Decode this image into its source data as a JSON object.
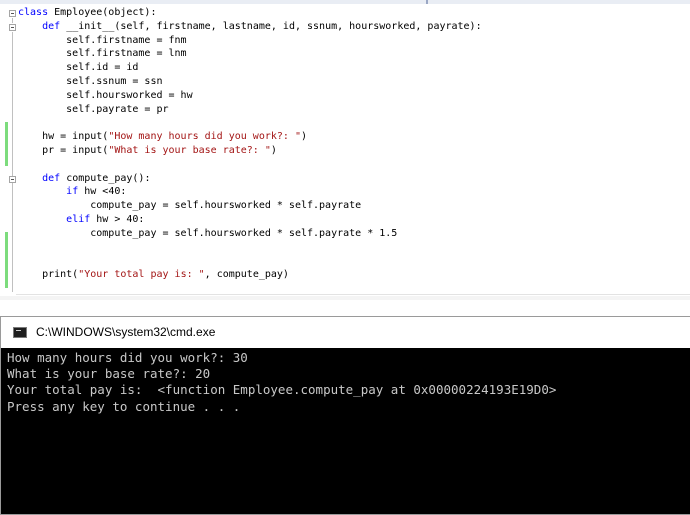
{
  "editor": {
    "lines": [
      [
        {
          "t": "class ",
          "c": "kw"
        },
        {
          "t": "Employee(object):",
          "c": ""
        }
      ],
      [
        {
          "t": "    ",
          "c": ""
        },
        {
          "t": "def ",
          "c": "kw"
        },
        {
          "t": "__init__(self, firstname, lastname, id, ssnum, hoursworked, payrate):",
          "c": ""
        }
      ],
      [
        {
          "t": "        self.firstname = fnm",
          "c": ""
        }
      ],
      [
        {
          "t": "        self.firstname = lnm",
          "c": ""
        }
      ],
      [
        {
          "t": "        self.id = id",
          "c": ""
        }
      ],
      [
        {
          "t": "        self.ssnum = ssn",
          "c": ""
        }
      ],
      [
        {
          "t": "        self.hoursworked = hw",
          "c": ""
        }
      ],
      [
        {
          "t": "        self.payrate = pr",
          "c": ""
        }
      ],
      [],
      [
        {
          "t": "    hw = input(",
          "c": ""
        },
        {
          "t": "\"How many hours did you work?: \"",
          "c": "str"
        },
        {
          "t": ")",
          "c": ""
        }
      ],
      [
        {
          "t": "    pr = input(",
          "c": ""
        },
        {
          "t": "\"What is your base rate?: \"",
          "c": "str"
        },
        {
          "t": ")",
          "c": ""
        }
      ],
      [],
      [
        {
          "t": "    ",
          "c": ""
        },
        {
          "t": "def ",
          "c": "kw"
        },
        {
          "t": "compute_pay():",
          "c": ""
        }
      ],
      [
        {
          "t": "        ",
          "c": ""
        },
        {
          "t": "if ",
          "c": "kw"
        },
        {
          "t": "hw <40:",
          "c": ""
        }
      ],
      [
        {
          "t": "            compute_pay = self.hoursworked * self.payrate",
          "c": ""
        }
      ],
      [
        {
          "t": "        ",
          "c": ""
        },
        {
          "t": "elif ",
          "c": "kw"
        },
        {
          "t": "hw > 40:",
          "c": ""
        }
      ],
      [
        {
          "t": "            compute_pay = self.hoursworked * self.payrate * 1.5",
          "c": ""
        }
      ],
      [],
      [],
      [
        {
          "t": "    print(",
          "c": ""
        },
        {
          "t": "\"Your total pay is: \"",
          "c": "str"
        },
        {
          "t": ", compute_pay)",
          "c": ""
        }
      ]
    ]
  },
  "console": {
    "title": "C:\\WINDOWS\\system32\\cmd.exe",
    "icon": "cmd-icon",
    "output_lines": [
      "How many hours did you work?: 30",
      "What is your base rate?: 20",
      "Your total pay is:  <function Employee.compute_pay at 0x00000224193E19D0>",
      "Press any key to continue . . ."
    ]
  },
  "colors": {
    "keyword": "#0000ff",
    "string": "#a31515",
    "change_bar": "#7ddc7d",
    "console_bg": "#000000",
    "console_text": "#c8c8c8"
  }
}
